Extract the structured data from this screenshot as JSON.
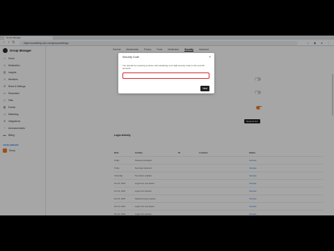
{
  "browser": {
    "tab_title": "Group Manager",
    "url": "https://something.onic.com/groups/settings"
  },
  "sidebar": {
    "title": "Group Manager",
    "items": [
      {
        "label": "Home",
        "icon": "home-icon"
      },
      {
        "label": "Moderation",
        "icon": "shield-icon"
      },
      {
        "label": "Insights",
        "icon": "chart-icon"
      },
      {
        "label": "Members",
        "icon": "people-icon"
      },
      {
        "label": "Rules & Settings",
        "icon": "gear-icon"
      },
      {
        "label": "Discussion",
        "icon": "chat-icon"
      },
      {
        "label": "Files",
        "icon": "file-icon"
      },
      {
        "label": "Events",
        "icon": "calendar-icon"
      },
      {
        "label": "Marketing",
        "icon": "megaphone-icon"
      },
      {
        "label": "Integrations",
        "icon": "plug-icon"
      },
      {
        "label": "Announcements",
        "icon": "bell-icon"
      },
      {
        "label": "Billing",
        "icon": "card-icon"
      }
    ],
    "section_label": "YOUR GROUPS",
    "group_label": "Group"
  },
  "main": {
    "tabs": [
      "General",
      "Membership",
      "Privacy",
      "Posts",
      "Moderation",
      "Security",
      "Advanced"
    ],
    "active_tab": "Security",
    "setting_toggle_on": true,
    "section_lower_title": "Login Activity",
    "button_label": "Request link",
    "table": {
      "headers": [
        "Date",
        "Activity",
        "IP",
        "Location",
        "Status"
      ],
      "rows": [
        [
          "Today",
          "Password changed",
          "",
          "",
          "Success"
        ],
        [
          "Today",
          "New login detected",
          "",
          "",
          "Success"
        ],
        [
          "Yesterday",
          "Two-factor enabled",
          "",
          "",
          "Success"
        ],
        [
          "Oct 14, 2023",
          "Login from new device",
          "",
          "",
          "Success"
        ],
        [
          "Oct 13, 2023",
          "Login from browser",
          "",
          "",
          "Success"
        ],
        [
          "Oct 12, 2023",
          "Password reset request",
          "",
          "",
          "Success"
        ],
        [
          "Oct 11, 2023",
          "Login from new device",
          "",
          "",
          "Success"
        ],
        [
          "Oct 10, 2023",
          "Login from browser",
          "",
          "",
          "Success"
        ]
      ]
    }
  },
  "modal": {
    "title": "Security Code",
    "text": "You should be receiving a phone call containing a six digit security code in the next 60 seconds.",
    "input_value": "",
    "next_label": "Next"
  },
  "colors": {
    "accent": "#f07c24",
    "error_border": "#d21f2a",
    "overlay": "rgba(0,0,0,0.35)"
  }
}
